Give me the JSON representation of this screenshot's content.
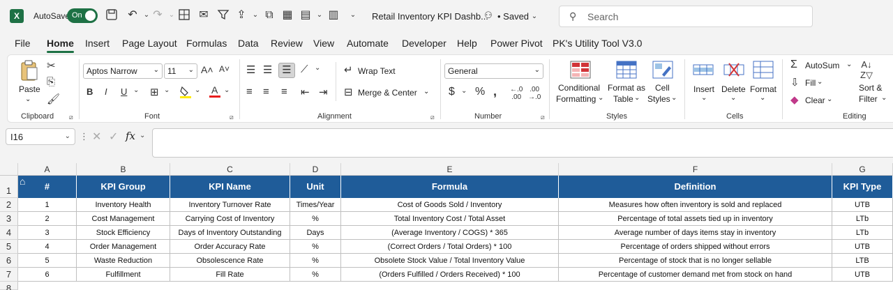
{
  "titlebar": {
    "autosave_label": "AutoSave",
    "autosave_state": "On",
    "doc_title": "Retail Inventory KPI Dashb...",
    "save_status": "• Saved",
    "search_placeholder": "Search"
  },
  "menu": {
    "tabs": [
      "File",
      "Home",
      "Insert",
      "Page Layout",
      "Formulas",
      "Data",
      "Review",
      "View",
      "Automate",
      "Developer",
      "Help",
      "Power Pivot",
      "PK's Utility Tool V3.0"
    ],
    "active": "Home"
  },
  "ribbon": {
    "clipboard": {
      "paste": "Paste",
      "label": "Clipboard"
    },
    "font": {
      "name": "Aptos Narrow",
      "size": "11",
      "label": "Font"
    },
    "alignment": {
      "wrap": "Wrap Text",
      "merge": "Merge & Center",
      "label": "Alignment"
    },
    "number": {
      "format": "General",
      "label": "Number"
    },
    "styles": {
      "conditional_1": "Conditional",
      "conditional_2": "Formatting",
      "format_table_1": "Format as",
      "format_table_2": "Table",
      "cell_styles_1": "Cell",
      "cell_styles_2": "Styles",
      "label": "Styles"
    },
    "cells": {
      "insert": "Insert",
      "delete": "Delete",
      "format": "Format",
      "label": "Cells"
    },
    "editing": {
      "autosum": "AutoSum",
      "fill": "Fill",
      "clear": "Clear",
      "sort_1": "Sort &",
      "sort_2": "Filter",
      "label": "Editing"
    }
  },
  "formula_bar": {
    "name_box": "I16",
    "fx": "fx",
    "value": ""
  },
  "sheet": {
    "columns": [
      "A",
      "B",
      "C",
      "D",
      "E",
      "F",
      "G"
    ],
    "headers": [
      "#",
      "KPI Group",
      "KPI Name",
      "Unit",
      "Formula",
      "Definition",
      "KPI Type"
    ],
    "rows": [
      [
        "1",
        "Inventory Health",
        "Inventory Turnover Rate",
        "Times/Year",
        "Cost of Goods Sold / Inventory",
        "Measures how often inventory is sold and replaced",
        "UTB"
      ],
      [
        "2",
        "Cost Management",
        "Carrying Cost of Inventory",
        "%",
        "Total Inventory Cost / Total Asset",
        "Percentage of total assets tied up in inventory",
        "LTb"
      ],
      [
        "3",
        "Stock Efficiency",
        "Days of Inventory Outstanding",
        "Days",
        "(Average Inventory / COGS) * 365",
        "Average number of days items stay in inventory",
        "LTb"
      ],
      [
        "4",
        "Order Management",
        "Order Accuracy Rate",
        "%",
        "(Correct Orders / Total Orders) * 100",
        "Percentage of orders shipped without errors",
        "UTB"
      ],
      [
        "5",
        "Waste Reduction",
        "Obsolescence Rate",
        "%",
        "Obsolete Stock Value / Total Inventory Value",
        "Percentage of stock that is no longer sellable",
        "LTB"
      ],
      [
        "6",
        "Fulfillment",
        "Fill Rate",
        "%",
        "(Orders Fulfilled / Orders Received) * 100",
        "Percentage of customer demand met from stock on hand",
        "UTB"
      ]
    ],
    "row_numbers": [
      "1",
      "2",
      "3",
      "4",
      "5",
      "6",
      "7",
      "8"
    ]
  }
}
